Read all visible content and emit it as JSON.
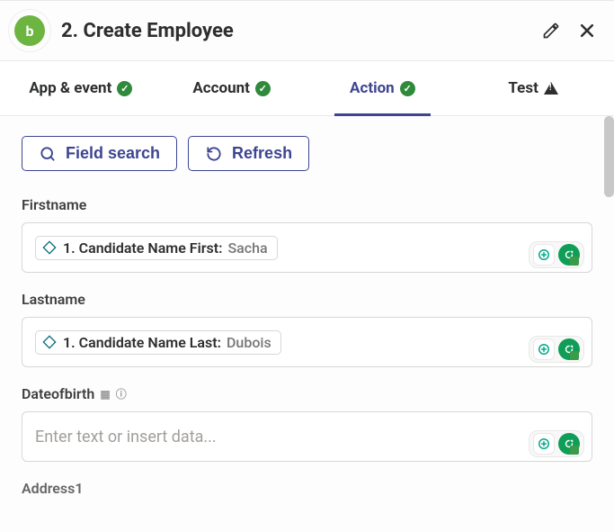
{
  "header": {
    "step_title": "2. Create Employee",
    "app_letter": "b"
  },
  "tabs": [
    {
      "label": "App & event",
      "status": "check",
      "active": false
    },
    {
      "label": "Account",
      "status": "check",
      "active": false
    },
    {
      "label": "Action",
      "status": "check",
      "active": true
    },
    {
      "label": "Test",
      "status": "warn",
      "active": false
    }
  ],
  "buttons": {
    "field_search": "Field search",
    "refresh": "Refresh"
  },
  "fields": {
    "firstname": {
      "label": "Firstname",
      "token_label": "1. Candidate Name First:",
      "token_value": "Sacha"
    },
    "lastname": {
      "label": "Lastname",
      "token_label": "1. Candidate Name Last:",
      "token_value": "Dubois"
    },
    "dob": {
      "label": "Dateofbirth",
      "placeholder": "Enter text or insert data..."
    },
    "truncated_next": "Address1"
  }
}
